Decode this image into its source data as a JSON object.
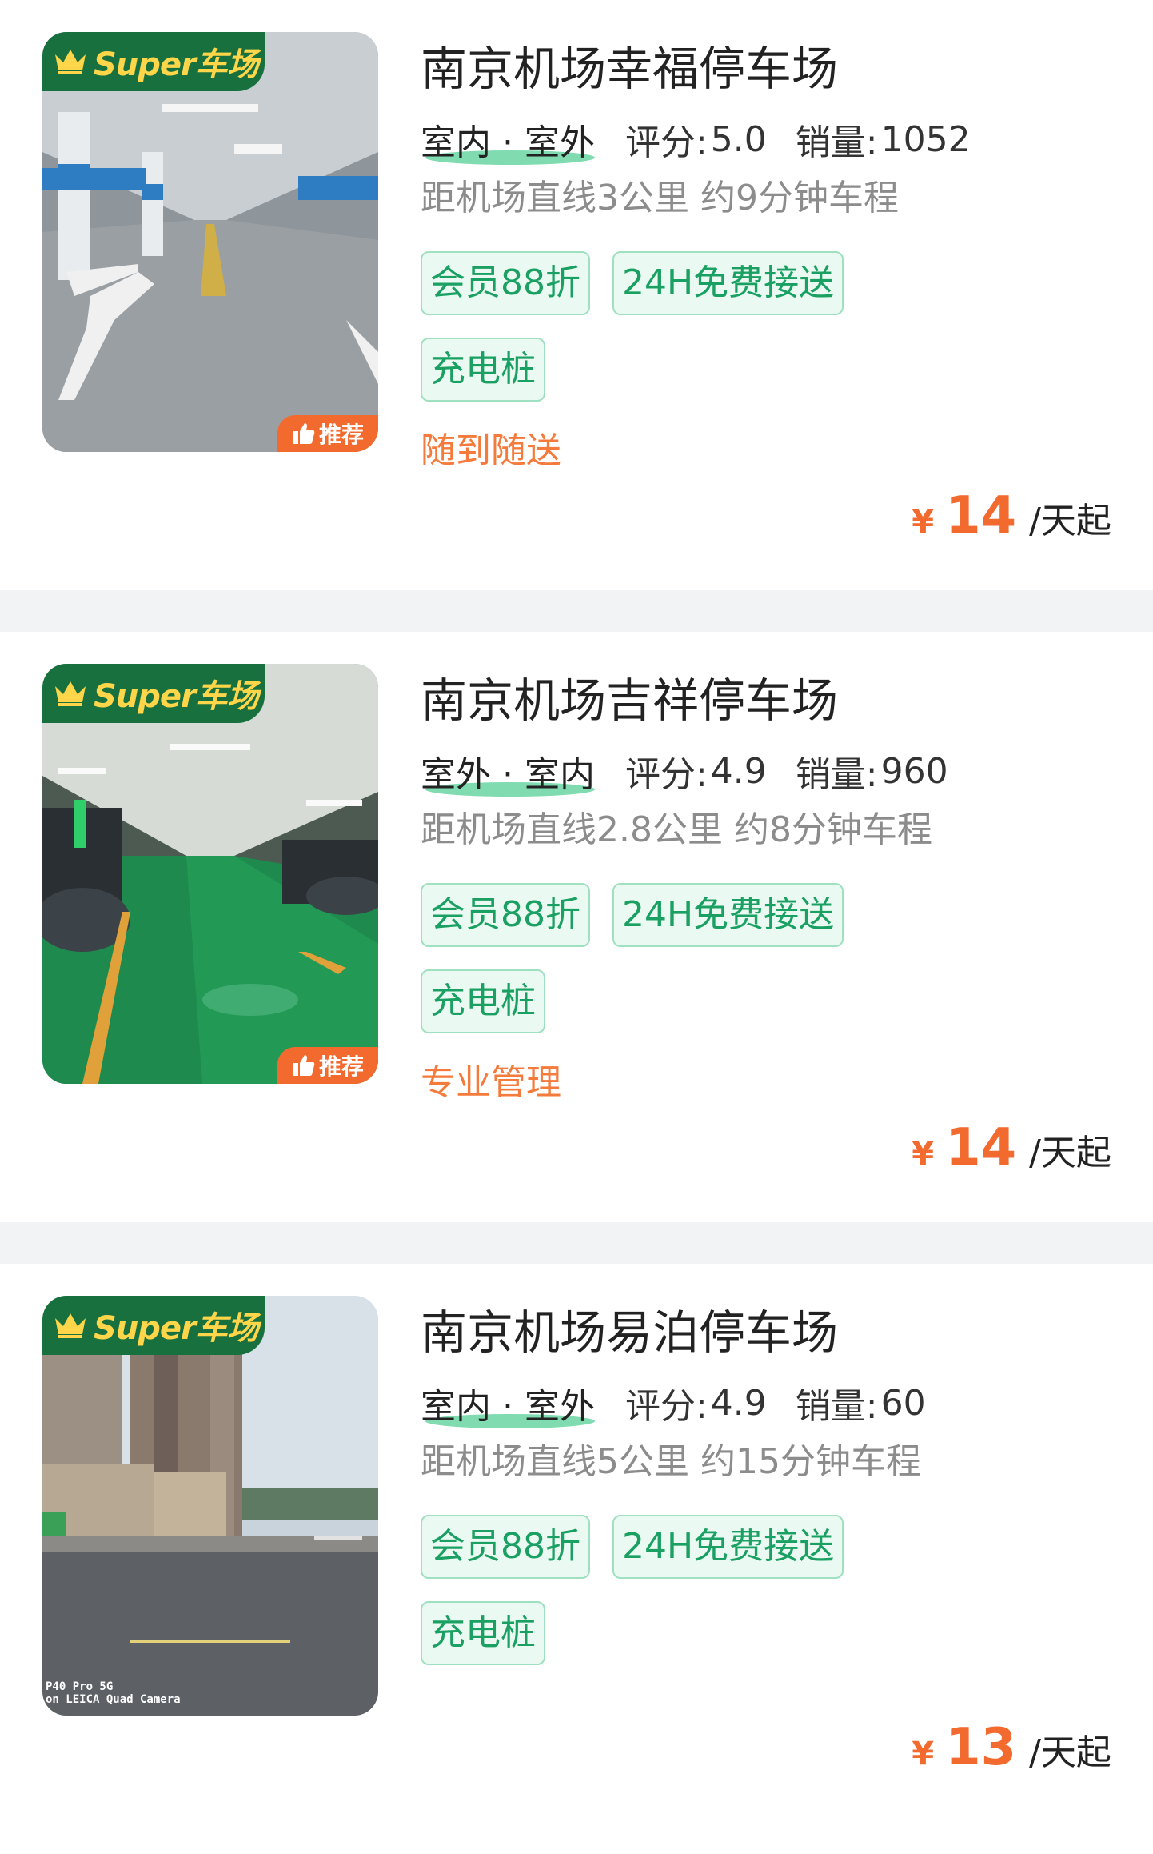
{
  "colors": {
    "accent_green": "#1aa062",
    "badge_green": "#17703d",
    "badge_gold": "#ffd54a",
    "price_orange": "#f26a2e",
    "slogan_orange": "#f47b3c"
  },
  "lots": [
    {
      "super_badge": "Super车场",
      "recommend_badge": "推荐",
      "name": "南京机场幸福停车场",
      "env_type": "室内 · 室外",
      "rating_label": "评分:",
      "rating": "5.0",
      "sales_label": "销量:",
      "sales": "1052",
      "distance": "距机场直线3公里 约9分钟车程",
      "tags": [
        "会员88折",
        "24H免费接送",
        "充电桩"
      ],
      "slogan": "随到随送",
      "currency": "¥",
      "price": "14",
      "price_unit": "/天起",
      "photo_icon": "recommend-thumb-icon"
    },
    {
      "super_badge": "Super车场",
      "recommend_badge": "推荐",
      "name": "南京机场吉祥停车场",
      "env_type": "室外 · 室内",
      "rating_label": "评分:",
      "rating": "4.9",
      "sales_label": "销量:",
      "sales": "960",
      "distance": "距机场直线2.8公里 约8分钟车程",
      "tags": [
        "会员88折",
        "24H免费接送",
        "充电桩"
      ],
      "slogan": "专业管理",
      "currency": "¥",
      "price": "14",
      "price_unit": "/天起",
      "photo_icon": "recommend-thumb-icon"
    },
    {
      "super_badge": "Super车场",
      "name": "南京机场易泊停车场",
      "env_type": "室内 · 室外",
      "rating_label": "评分:",
      "rating": "4.9",
      "sales_label": "销量:",
      "sales": "60",
      "distance": "距机场直线5公里 约15分钟车程",
      "tags": [
        "会员88折",
        "24H免费接送",
        "充电桩"
      ],
      "currency": "¥",
      "price": "13",
      "price_unit": "/天起",
      "watermark_line1": "P40 Pro 5G",
      "watermark_line2": "on LEICA Quad Camera"
    }
  ]
}
